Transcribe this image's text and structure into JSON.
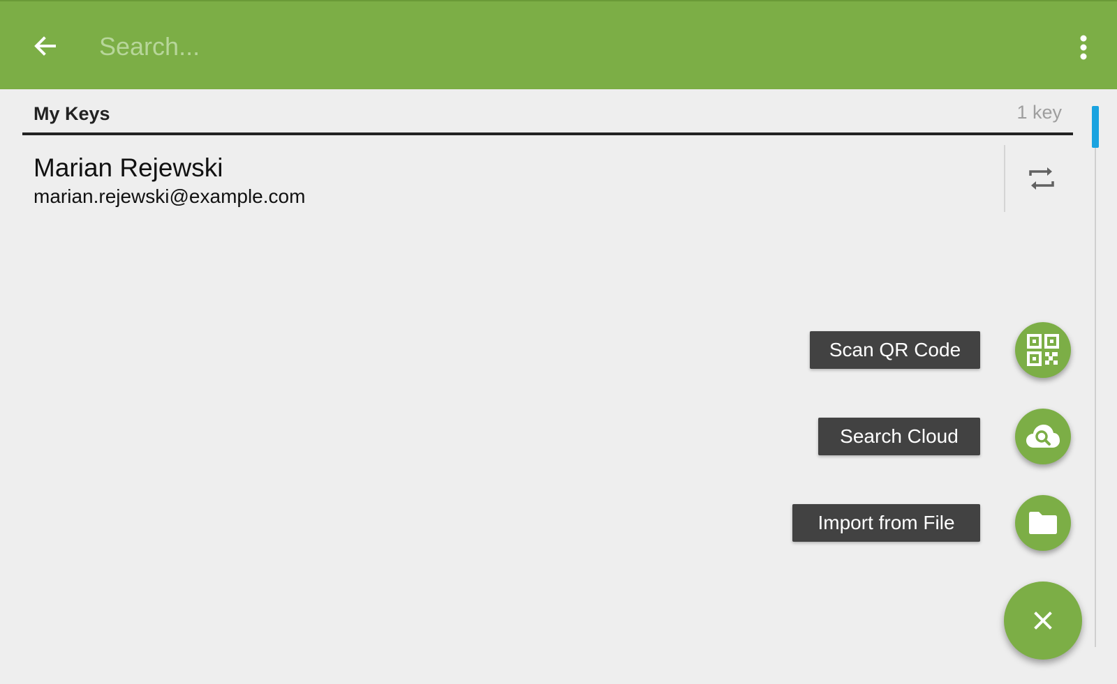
{
  "toolbar": {
    "back_icon": "arrow-left-icon",
    "search_placeholder": "Search...",
    "overflow_icon": "more-vert-icon",
    "background_color": "#7cae46"
  },
  "keys_section": {
    "title": "My Keys",
    "count": "1 key"
  },
  "keys": [
    {
      "name": "Marian Rejewski",
      "email": "marian.rejewski@example.com",
      "action_icon": "sync-icon"
    }
  ],
  "fab_menu": {
    "items": [
      {
        "label": "Scan QR Code",
        "icon": "qr-code-icon"
      },
      {
        "label": "Search Cloud",
        "icon": "cloud-search-icon"
      },
      {
        "label": "Import from File",
        "icon": "folder-icon"
      }
    ],
    "close_icon": "close-icon",
    "accent_color": "#7cae46",
    "label_background": "#424242"
  },
  "scrollbar": {
    "thumb_color": "#1aa3e0"
  }
}
